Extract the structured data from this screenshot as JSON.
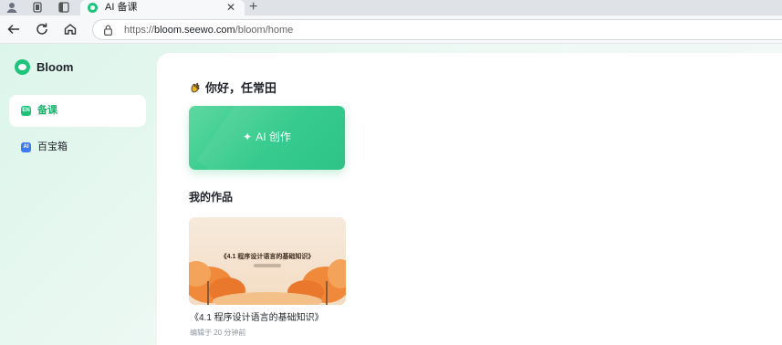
{
  "browser": {
    "tab_title": "AI 备课",
    "tab_close": "✕",
    "new_tab": "+",
    "url_scheme": "https://",
    "url_host": "bloom.seewo.com",
    "url_path": "/bloom/home",
    "icons": [
      "profile-icon",
      "collections-icon",
      "tab-actions-icon",
      "back-icon",
      "refresh-icon",
      "home-icon",
      "lock-icon"
    ]
  },
  "app": {
    "brand": "Bloom",
    "brand_color": "#1fc47a",
    "nav": [
      {
        "label": "备课",
        "badge": "EN",
        "active": true,
        "color": "#22c17a"
      },
      {
        "label": "百宝箱",
        "badge": "AI",
        "active": false,
        "color": "#3d7bf5"
      }
    ]
  },
  "main": {
    "greeting": "你好，任常田",
    "ai_button_label": "AI 创作",
    "section_title": "我的作品",
    "work": {
      "thumb_title": "《4.1 程序设计语言的基础知识》",
      "name": "《4.1 程序设计语言的基础知识》",
      "edited": "编辑于 20 分钟前"
    }
  }
}
